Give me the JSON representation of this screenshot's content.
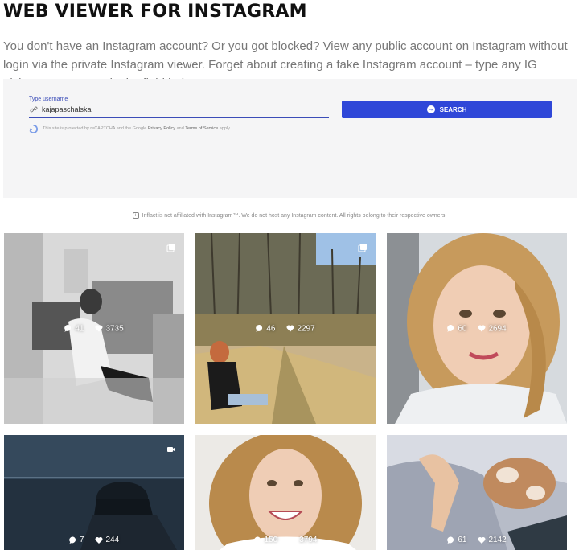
{
  "header": {
    "title": "WEB VIEWER FOR INSTAGRAM",
    "intro": "You don't have an Instagram account? Or you got blocked? View any public account on Instagram without login via the private Instagram viewer. Forget about creating a fake Instagram account – type any IG nickname you want in the field below:"
  },
  "search": {
    "label": "Type username",
    "value": "kajapaschalska",
    "button_label": "SEARCH",
    "recaptcha_prefix": "This site is protected by reCAPTCHA and the Google ",
    "privacy_link": "Privacy Policy",
    "and_text": " and ",
    "terms_link": "Terms of Service",
    "recaptcha_suffix": " apply."
  },
  "disclaimer": "Inflact is not affiliated with Instagram™. We do not host any Instagram content. All rights belong to their respective owners.",
  "posts": [
    {
      "comments": "41",
      "likes": "3735",
      "type_icon": "carousel-icon"
    },
    {
      "comments": "46",
      "likes": "2297",
      "type_icon": "carousel-icon"
    },
    {
      "comments": "60",
      "likes": "2694",
      "type_icon": ""
    },
    {
      "comments": "7",
      "likes": "244",
      "type_icon": "video-icon"
    },
    {
      "comments": "150",
      "likes": "3794",
      "type_icon": ""
    },
    {
      "comments": "61",
      "likes": "2142",
      "type_icon": ""
    }
  ],
  "colors": {
    "accent": "#2f47d8",
    "panel_bg": "#f5f5f6"
  }
}
